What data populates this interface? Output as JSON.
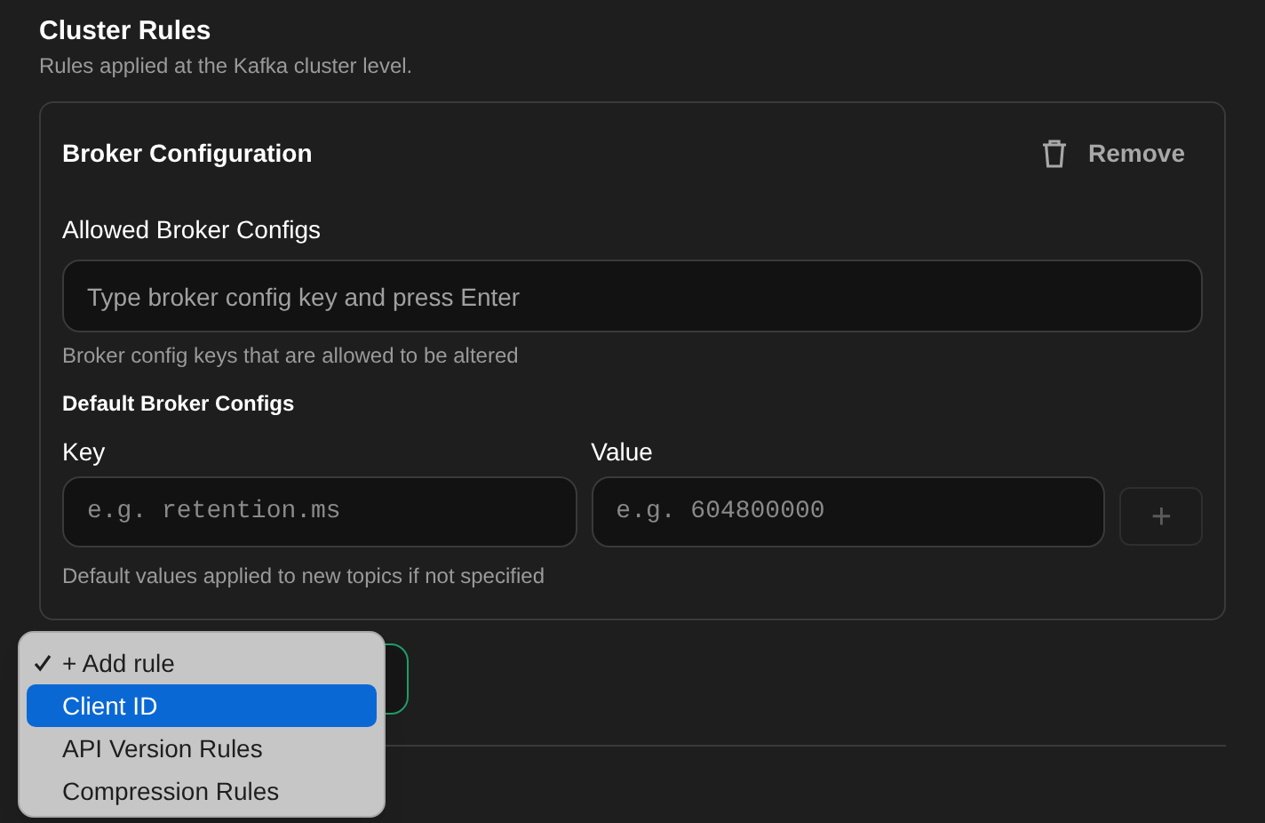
{
  "section": {
    "title": "Cluster Rules",
    "description": "Rules applied at the Kafka cluster level."
  },
  "card": {
    "title": "Broker Configuration",
    "remove_label": "Remove",
    "allowed": {
      "label": "Allowed Broker Configs",
      "placeholder": "Type broker config key and press Enter",
      "hint": "Broker config keys that are allowed to be altered"
    },
    "defaults": {
      "title": "Default Broker Configs",
      "key_label": "Key",
      "key_placeholder": "e.g. retention.ms",
      "value_label": "Value",
      "value_placeholder": "e.g. 604800000",
      "add_symbol": "+",
      "hint": "Default values applied to new topics if not specified"
    }
  },
  "dropdown": {
    "items": [
      {
        "label": "+ Add rule",
        "checked": true,
        "selected": false
      },
      {
        "label": "Client ID",
        "checked": false,
        "selected": true
      },
      {
        "label": "API Version Rules",
        "checked": false,
        "selected": false
      },
      {
        "label": "Compression Rules",
        "checked": false,
        "selected": false
      }
    ]
  }
}
